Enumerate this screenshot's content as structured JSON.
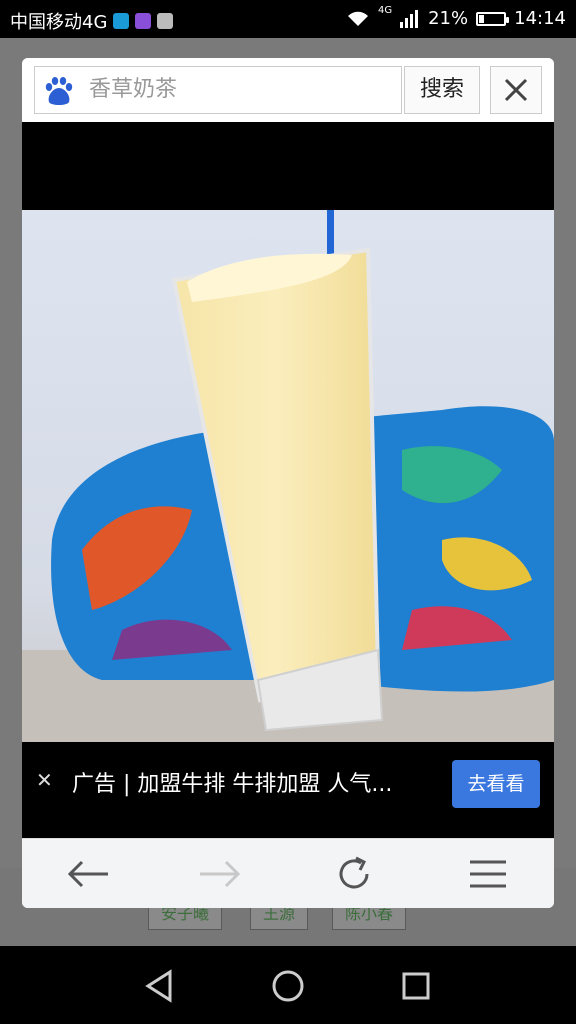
{
  "status_bar": {
    "carrier": "中国移动4G",
    "network": "4G",
    "battery": "21%",
    "battery_fraction": 0.21,
    "time": "14:14"
  },
  "search": {
    "query": "香草奶茶",
    "button": "搜索"
  },
  "ad": {
    "text": "广告 | 加盟牛排 牛排加盟 人气...",
    "cta": "去看看"
  },
  "background_tags": [
    "安子曦",
    "王源",
    "陈小春"
  ],
  "colors": {
    "accent": "#3a78e0",
    "baidu_blue": "#2d5fd4"
  },
  "icons": {
    "back": "arrow-left-icon",
    "forward": "arrow-right-icon",
    "refresh": "refresh-icon",
    "menu": "menu-icon"
  }
}
